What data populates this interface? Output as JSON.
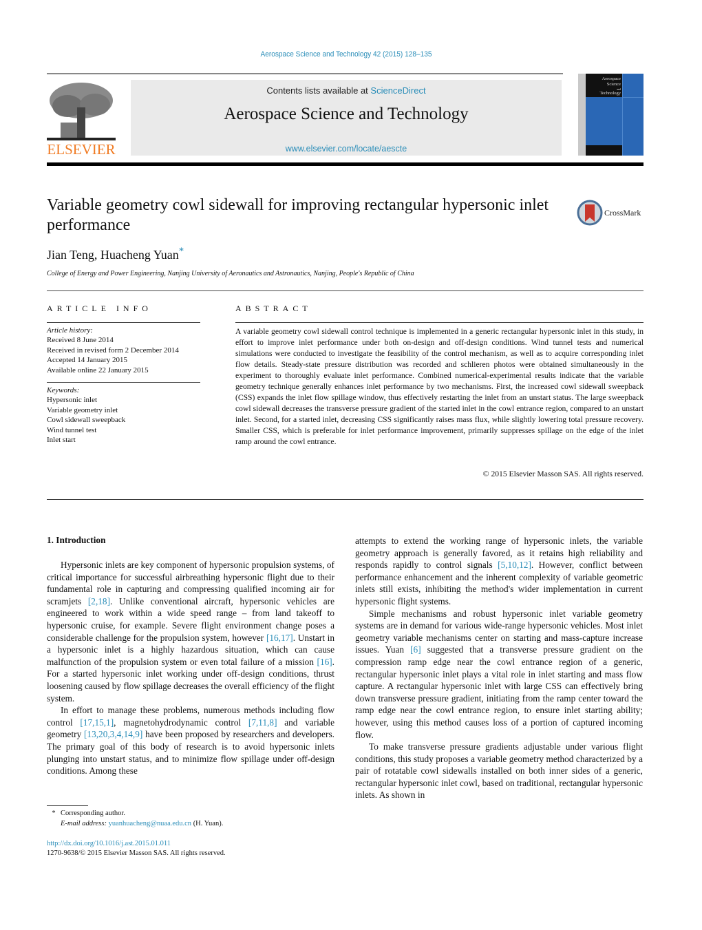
{
  "header": {
    "journal_ref": "Aerospace Science and Technology 42 (2015) 128–135",
    "contents_prefix": "Contents lists available at ",
    "contents_link": "ScienceDirect",
    "journal_title": "Aerospace Science and Technology",
    "journal_url": "www.elsevier.com/locate/aescte",
    "publisher_logo_text": "ELSEVIER",
    "cover_title_lines": [
      "Aerospace",
      "Science",
      "and",
      "Technology"
    ],
    "accent_color": "#2a8db8",
    "logo_color": "#f07a22"
  },
  "article": {
    "title": "Variable geometry cowl sidewall for improving rectangular hypersonic inlet performance",
    "crossmark_label": "CrossMark",
    "authors": "Jian Teng, Huacheng Yuan",
    "corresponding_marker": "*",
    "affiliation": "College of Energy and Power Engineering, Nanjing University of Aeronautics and Astronautics, Nanjing, People's Republic of China"
  },
  "article_info": {
    "heading": "ARTICLE INFO",
    "history_label": "Article history:",
    "history": [
      "Received 8 June 2014",
      "Received in revised form 2 December 2014",
      "Accepted 14 January 2015",
      "Available online 22 January 2015"
    ],
    "keywords_label": "Keywords:",
    "keywords": [
      "Hypersonic inlet",
      "Variable geometry inlet",
      "Cowl sidewall sweepback",
      "Wind tunnel test",
      "Inlet start"
    ]
  },
  "abstract": {
    "heading": "ABSTRACT",
    "text": "A variable geometry cowl sidewall control technique is implemented in a generic rectangular hypersonic inlet in this study, in effort to improve inlet performance under both on-design and off-design conditions. Wind tunnel tests and numerical simulations were conducted to investigate the feasibility of the control mechanism, as well as to acquire corresponding inlet flow details. Steady-state pressure distribution was recorded and schlieren photos were obtained simultaneously in the experiment to thoroughly evaluate inlet performance. Combined numerical-experimental results indicate that the variable geometry technique generally enhances inlet performance by two mechanisms. First, the increased cowl sidewall sweepback (CSS) expands the inlet flow spillage window, thus effectively restarting the inlet from an unstart status. The large sweepback cowl sidewall decreases the transverse pressure gradient of the started inlet in the cowl entrance region, compared to an unstart inlet. Second, for a started inlet, decreasing CSS significantly raises mass flux, while slightly lowering total pressure recovery. Smaller CSS, which is preferable for inlet performance improvement, primarily suppresses spillage on the edge of the inlet ramp around the cowl entrance.",
    "copyright": "© 2015 Elsevier Masson SAS. All rights reserved."
  },
  "body": {
    "section_heading": "1.  Introduction",
    "left_paragraphs": [
      [
        {
          "t": "Hypersonic inlets are key component of hypersonic propulsion systems, of critical importance for successful airbreathing hyper­sonic flight due to their fundamental role in capturing and com­pressing qualified incoming air for scramjets "
        },
        {
          "t": "[2,18]",
          "ref": true
        },
        {
          "t": ". Unlike conven­tional aircraft, hypersonic vehicles are engineered to work within a wide speed range – from land takeoff to hypersonic cruise, for example. Severe flight environment change poses a considerable challenge for the propulsion system, however "
        },
        {
          "t": "[16,17]",
          "ref": true
        },
        {
          "t": ". Unstart in a hypersonic inlet is a highly hazardous situation, which can cause malfunction of the propulsion system or even total failure of a mis­sion "
        },
        {
          "t": "[16]",
          "ref": true
        },
        {
          "t": ". For a started hypersonic inlet working under off-design conditions, thrust loosening caused by flow spillage decreases the overall efficiency of the flight system."
        }
      ],
      [
        {
          "t": "In effort to manage these problems, numerous methods includ­ing flow control "
        },
        {
          "t": "[17,15,1]",
          "ref": true
        },
        {
          "t": ", magnetohydrodynamic control "
        },
        {
          "t": "[7,11,8]",
          "ref": true
        },
        {
          "t": " and variable geometry "
        },
        {
          "t": "[13,20,3,4,14,9]",
          "ref": true
        },
        {
          "t": " have been proposed by re­searchers and developers. The primary goal of this body of research is to avoid hypersonic inlets plunging into unstart status, and to minimize flow spillage under off-design conditions. Among these"
        }
      ]
    ],
    "right_paragraphs": [
      [
        {
          "t": "attempts to extend the working range of hypersonic inlets, the variable geometry approach is generally favored, as it retains high reliability and responds rapidly to control signals "
        },
        {
          "t": "[5,10,12]",
          "ref": true
        },
        {
          "t": ". How­ever, conflict between performance enhancement and the inherent complexity of variable geometric inlets still exists, inhibiting the method's wider implementation in current hypersonic flight sys­tems."
        }
      ],
      [
        {
          "t": "Simple mechanisms and robust hypersonic inlet variable ge­ometry systems are in demand for various wide-range hypersonic vehicles. Most inlet geometry variable mechanisms center on start­ing and mass-capture increase issues. Yuan "
        },
        {
          "t": "[6]",
          "ref": true
        },
        {
          "t": " suggested that a transverse pressure gradient on the compression ramp edge near the cowl entrance region of a generic, rectangular hypersonic inlet plays a vital role in inlet starting and mass flow capture. A rect­angular hypersonic inlet with large CSS can effectively bring down transverse pressure gradient, initiating from the ramp center to­ward the ramp edge near the cowl entrance region, to ensure inlet starting ability; however, using this method causes loss of a por­tion of captured incoming flow."
        }
      ],
      [
        {
          "t": "To make transverse pressure gradients adjustable under various flight conditions, this study proposes a variable geometry method characterized by a pair of rotatable cowl sidewalls installed on both inner sides of a generic, rectangular hypersonic inlet cowl, based on traditional, rectangular hypersonic inlets. As shown in"
        }
      ]
    ]
  },
  "footnotes": {
    "marker": "*",
    "corresponding": "Corresponding author.",
    "email_label": "E-mail address: ",
    "email": "yuanhuacheng@nuaa.edu.cn",
    "email_suffix": " (H. Yuan).",
    "doi": "http://dx.doi.org/10.1016/j.ast.2015.01.011",
    "issn": "1270-9638/© 2015 Elsevier Masson SAS. All rights reserved."
  }
}
